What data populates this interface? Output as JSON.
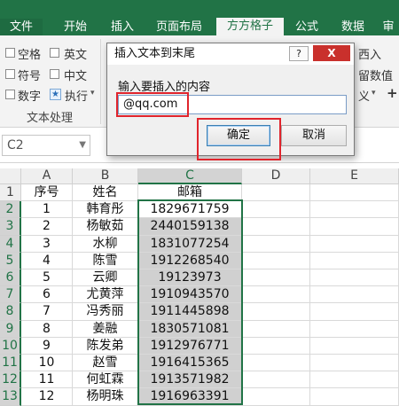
{
  "ribbon_tabs": [
    "文件",
    "开始",
    "插入",
    "页面布局",
    "方方格子",
    "公式",
    "数据",
    "审"
  ],
  "ribbon": {
    "items": [
      "空格",
      "英文",
      "符号",
      "中文",
      "数字",
      "执行"
    ],
    "right_partial": [
      "西入",
      "留数值",
      "义"
    ],
    "group_label": "文本处理"
  },
  "formula_bar": {
    "cell_ref": "C2"
  },
  "dialog": {
    "title": "插入文本到末尾",
    "help_label": "?",
    "close_label": "X",
    "prompt": "输入要插入的内容",
    "input_value": "@qq.com",
    "ok_label": "确定",
    "cancel_label": "取消"
  },
  "columns": [
    "A",
    "B",
    "C",
    "D",
    "E"
  ],
  "headers": [
    "序号",
    "姓名",
    "邮箱"
  ],
  "rows": [
    [
      "1",
      "韩育彤",
      "1829671759"
    ],
    [
      "2",
      "杨敏茹",
      "2440159138"
    ],
    [
      "3",
      "水柳",
      "1831077254"
    ],
    [
      "4",
      "陈雪",
      "1912268540"
    ],
    [
      "5",
      "云卿",
      "19123973"
    ],
    [
      "6",
      "尤黄萍",
      "1910943570"
    ],
    [
      "7",
      "冯秀丽",
      "1911445898"
    ],
    [
      "8",
      "姜融",
      "1830571081"
    ],
    [
      "9",
      "陈发弟",
      "1912976771"
    ],
    [
      "10",
      "赵雪",
      "1916415365"
    ],
    [
      "11",
      "何虹霖",
      "1913571982"
    ],
    [
      "12",
      "杨明珠",
      "1916963391"
    ]
  ],
  "row_numbers": [
    "1",
    "2",
    "3",
    "4",
    "5",
    "6",
    "7",
    "8",
    "9",
    "10",
    "11",
    "12",
    "13"
  ],
  "colors": {
    "excel_green": "#217346",
    "highlight_red": "#e0242c",
    "selection_gray": "#d0d0d0"
  }
}
